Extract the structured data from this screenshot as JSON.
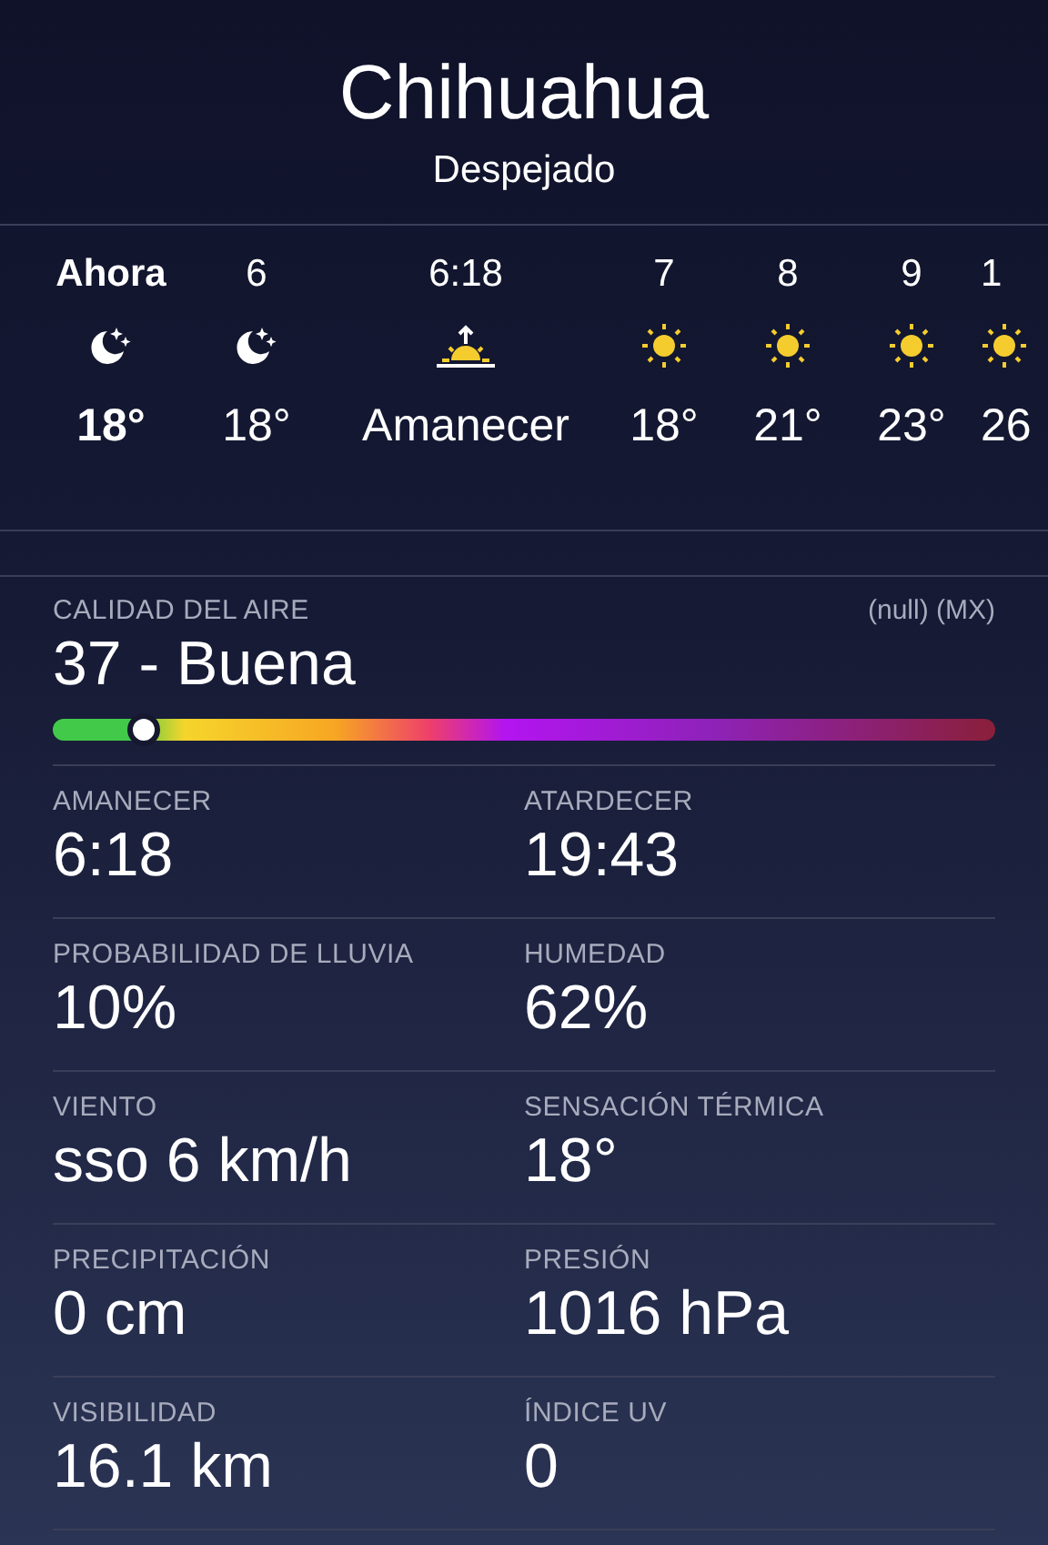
{
  "header": {
    "city": "Chihuahua",
    "condition": "Despejado"
  },
  "hourly": [
    {
      "time": "Ahora",
      "kind": "moon",
      "temp": "18°",
      "current": true
    },
    {
      "time": "6",
      "kind": "moon",
      "temp": "18°",
      "current": false
    },
    {
      "time": "6:18",
      "kind": "sunrise",
      "temp": "Amanecer",
      "current": false
    },
    {
      "time": "7",
      "kind": "sun",
      "temp": "18°",
      "current": false
    },
    {
      "time": "8",
      "kind": "sun",
      "temp": "21°",
      "current": false
    },
    {
      "time": "9",
      "kind": "sun",
      "temp": "23°",
      "current": false
    },
    {
      "time": "1",
      "kind": "sun",
      "temp": "26",
      "current": false
    }
  ],
  "air_quality": {
    "label": "CALIDAD DEL AIRE",
    "source": "(null) (MX)",
    "value": "37 - Buena",
    "level": 0.097
  },
  "details": [
    {
      "label": "AMANECER",
      "value": "6:18"
    },
    {
      "label": "ATARDECER",
      "value": "19:43"
    },
    {
      "label": "PROBABILIDAD DE LLUVIA",
      "value": "10%"
    },
    {
      "label": "HUMEDAD",
      "value": "62%"
    },
    {
      "label": "VIENTO",
      "value": "sso 6 km/h"
    },
    {
      "label": "SENSACIÓN TÉRMICA",
      "value": "18°"
    },
    {
      "label": "PRECIPITACIÓN",
      "value": "0 cm"
    },
    {
      "label": "PRESIÓN",
      "value": "1016 hPa"
    },
    {
      "label": "VISIBILIDAD",
      "value": "16.1 km"
    },
    {
      "label": "ÍNDICE UV",
      "value": "0"
    }
  ]
}
